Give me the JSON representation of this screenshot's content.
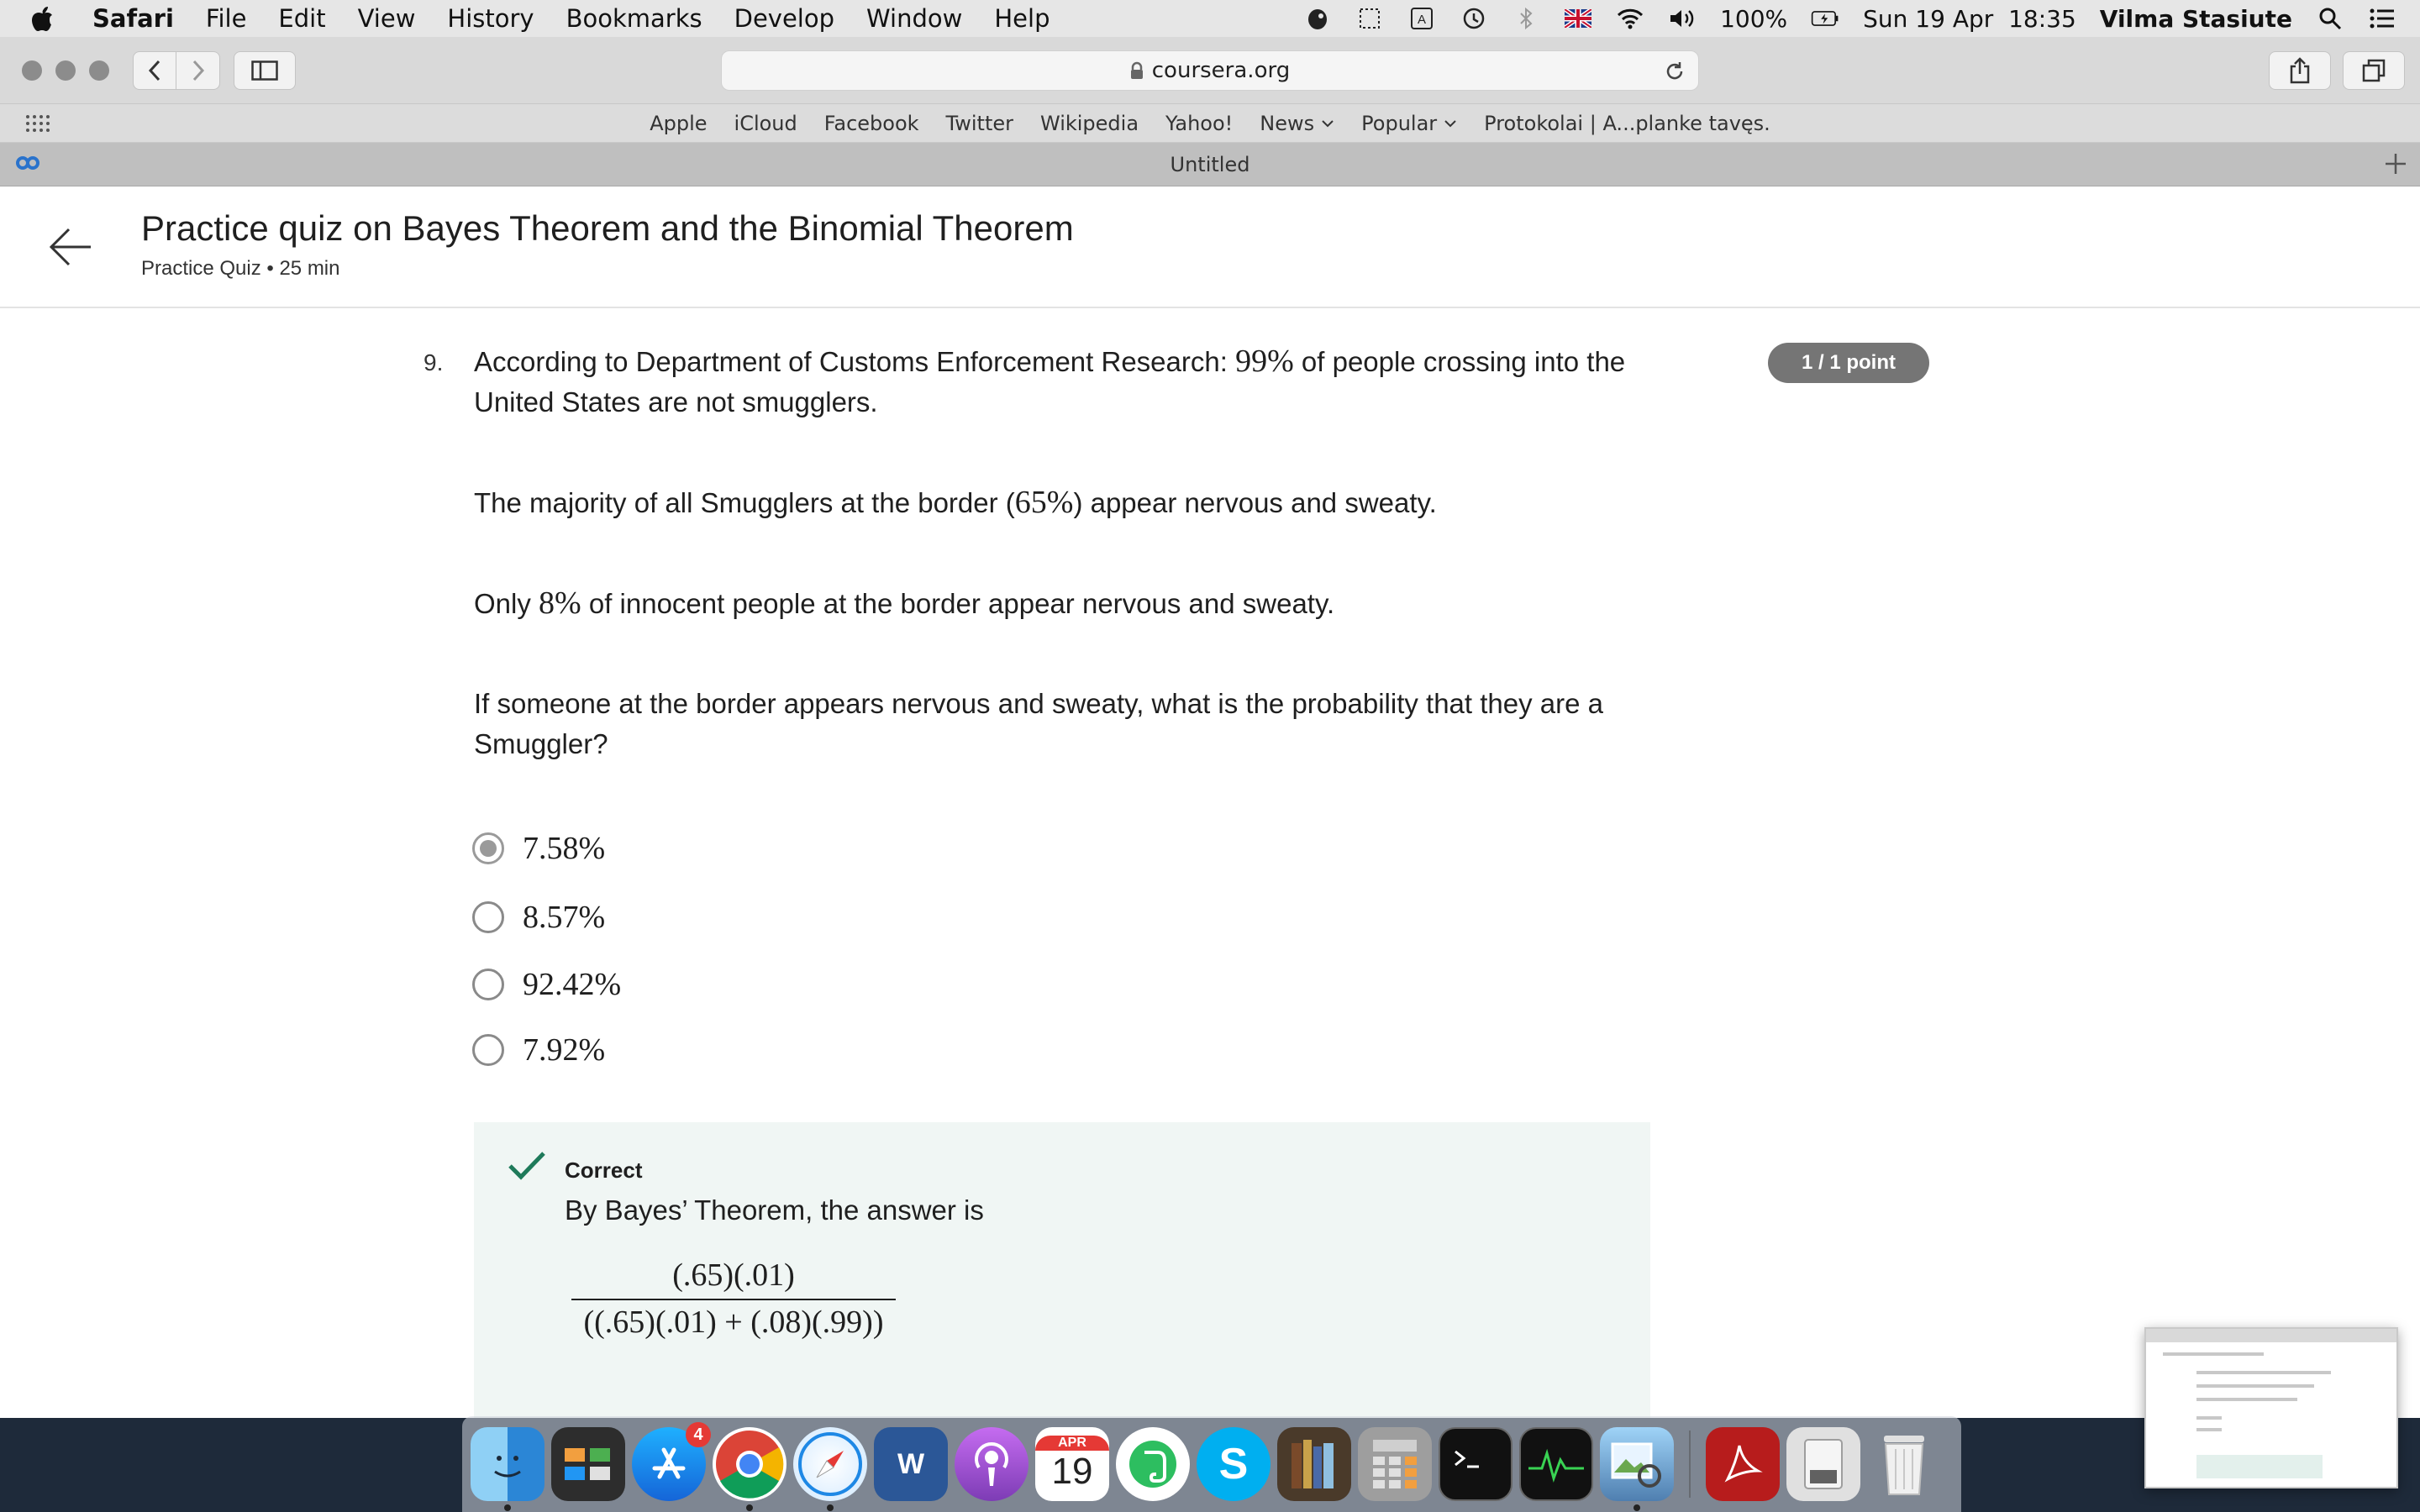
{
  "menubar": {
    "app_name": "Safari",
    "menus": [
      "File",
      "Edit",
      "View",
      "History",
      "Bookmarks",
      "Develop",
      "Window",
      "Help"
    ],
    "battery": "100%",
    "clock": "Sun 19 Apr  18:35",
    "user": "Vilma Stasiute"
  },
  "toolbar": {
    "url": "coursera.org"
  },
  "favorites": {
    "items": [
      "Apple",
      "iCloud",
      "Facebook",
      "Twitter",
      "Wikipedia",
      "Yahoo!"
    ],
    "dropdowns": [
      "News",
      "Popular"
    ],
    "last": "Protokolai | A...planke tavęs."
  },
  "tab": {
    "title": "Untitled"
  },
  "header": {
    "title": "Practice quiz on Bayes Theorem and the Binomial Theorem",
    "subtitle": "Practice Quiz • 25 min"
  },
  "question": {
    "number": "9.",
    "score": "1 / 1 point",
    "p1_a": "According to Department of Customs Enforcement Research: ",
    "p1_math": "99%",
    "p1_b": " of people crossing into the United States are not smugglers.",
    "p2_a": "The majority of all Smugglers at the border (",
    "p2_math": "65%",
    "p2_b": ") appear nervous and sweaty.",
    "p3_a": "Only ",
    "p3_math": "8%",
    "p3_b": " of innocent people at the border appear nervous and sweaty.",
    "p4": "If someone at the border appears nervous and sweaty, what is the probability that they are a Smuggler?",
    "options": [
      "7.58%",
      "8.57%",
      "92.42%",
      "7.92%"
    ],
    "selected_index": 0
  },
  "feedback": {
    "status": "Correct",
    "text": "By Bayes’ Theorem, the answer is",
    "numerator": "(.65)(.01)",
    "denominator": "((.65)(.01) + (.08)(.99))"
  },
  "dock": {
    "appstore_badge": "4",
    "calendar_month": "APR",
    "calendar_day": "19"
  },
  "colors": {
    "badge": "#757575",
    "feedback_bg": "#f0f6f4",
    "check": "#1e7a5a"
  }
}
